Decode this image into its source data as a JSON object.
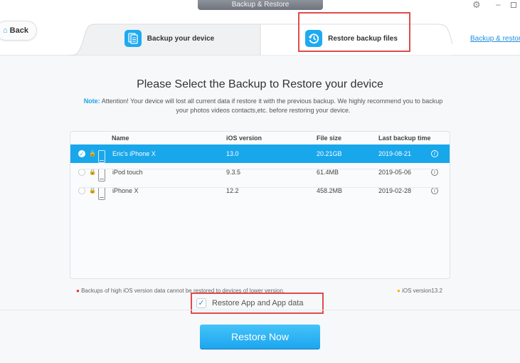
{
  "window": {
    "title": "Backup & Restore",
    "controls": {
      "settings_icon": "gear-icon",
      "minimize_icon": "minimize-icon",
      "maximize_icon": "maximize-icon"
    }
  },
  "header": {
    "back_label": "Back",
    "tabs": [
      {
        "label": "Backup your device",
        "icon": "backup-documents-icon",
        "active": false
      },
      {
        "label": "Restore backup files",
        "icon": "restore-clock-icon",
        "active": true
      }
    ],
    "help_link": "Backup & restor..."
  },
  "main": {
    "title": "Please Select the Backup to Restore your device",
    "note_label": "Note:",
    "note_text": "Attention! Your device will lost all current data if restore it with the previous backup. We highly recommend you to backup your photos videos contacts,etc. before restoring your device."
  },
  "table": {
    "columns": [
      "Name",
      "iOS version",
      "File size",
      "Last backup time"
    ],
    "rows": [
      {
        "name": "Eric's iPhone X",
        "ios": "13.0",
        "size": "20.21GB",
        "date": "2019-08-21",
        "selected": true
      },
      {
        "name": "iPod touch",
        "ios": "9.3.5",
        "size": "61.4MB",
        "date": "2019-05-06",
        "selected": false
      },
      {
        "name": "iPhone X",
        "ios": "12.2",
        "size": "458.2MB",
        "date": "2019-02-28",
        "selected": false
      }
    ]
  },
  "footer": {
    "warning": "Backups of high iOS version data cannot be restored to devices of lower version.",
    "device_ios": "iOS version13.2",
    "restore_app_label": "Restore App and App data",
    "restore_app_checked": true,
    "restore_now_label": "Restore Now"
  },
  "colors": {
    "accent": "#1eaaf1",
    "selected_row": "#19a7ec",
    "highlight_box": "#e04b4b",
    "warning_dot": "#e5302a",
    "info_dot": "#f5b400"
  }
}
